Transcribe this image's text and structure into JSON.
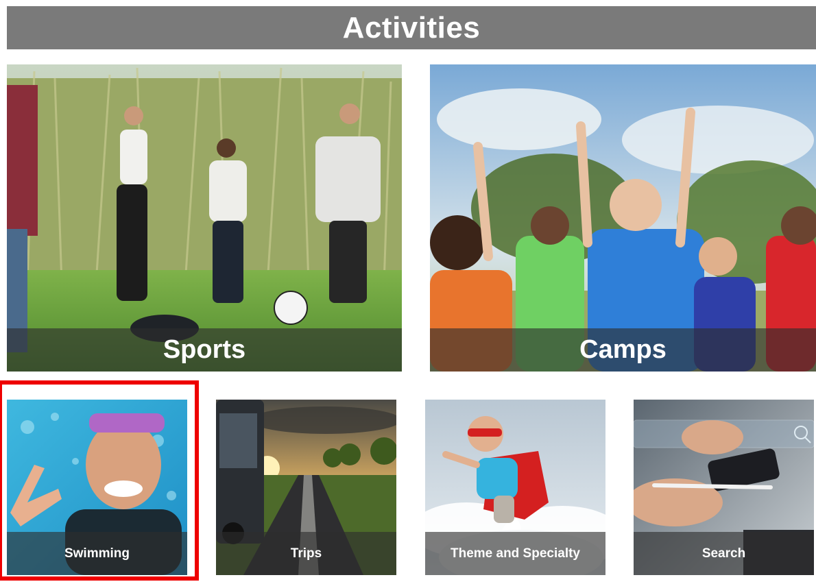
{
  "header": {
    "title": "Activities"
  },
  "large_tiles": [
    {
      "label": "Sports",
      "image": "teens-playing-soccer-photo"
    },
    {
      "label": "Camps",
      "image": "kids-cheering-outdoors-photo"
    }
  ],
  "small_tiles": [
    {
      "label": "Swimming",
      "image": "girl-in-pool-photo",
      "highlighted": true
    },
    {
      "label": "Trips",
      "image": "bus-on-road-sunset-photo"
    },
    {
      "label": "Theme and Specialty",
      "image": "superhero-kid-flying-photo"
    },
    {
      "label": "Search",
      "image": "hands-with-phone-search-photo"
    }
  ],
  "colors": {
    "header_bg": "#7a7a7a",
    "highlight_border": "#ee0000",
    "caption_bg": "rgba(45,45,45,0.62)"
  }
}
